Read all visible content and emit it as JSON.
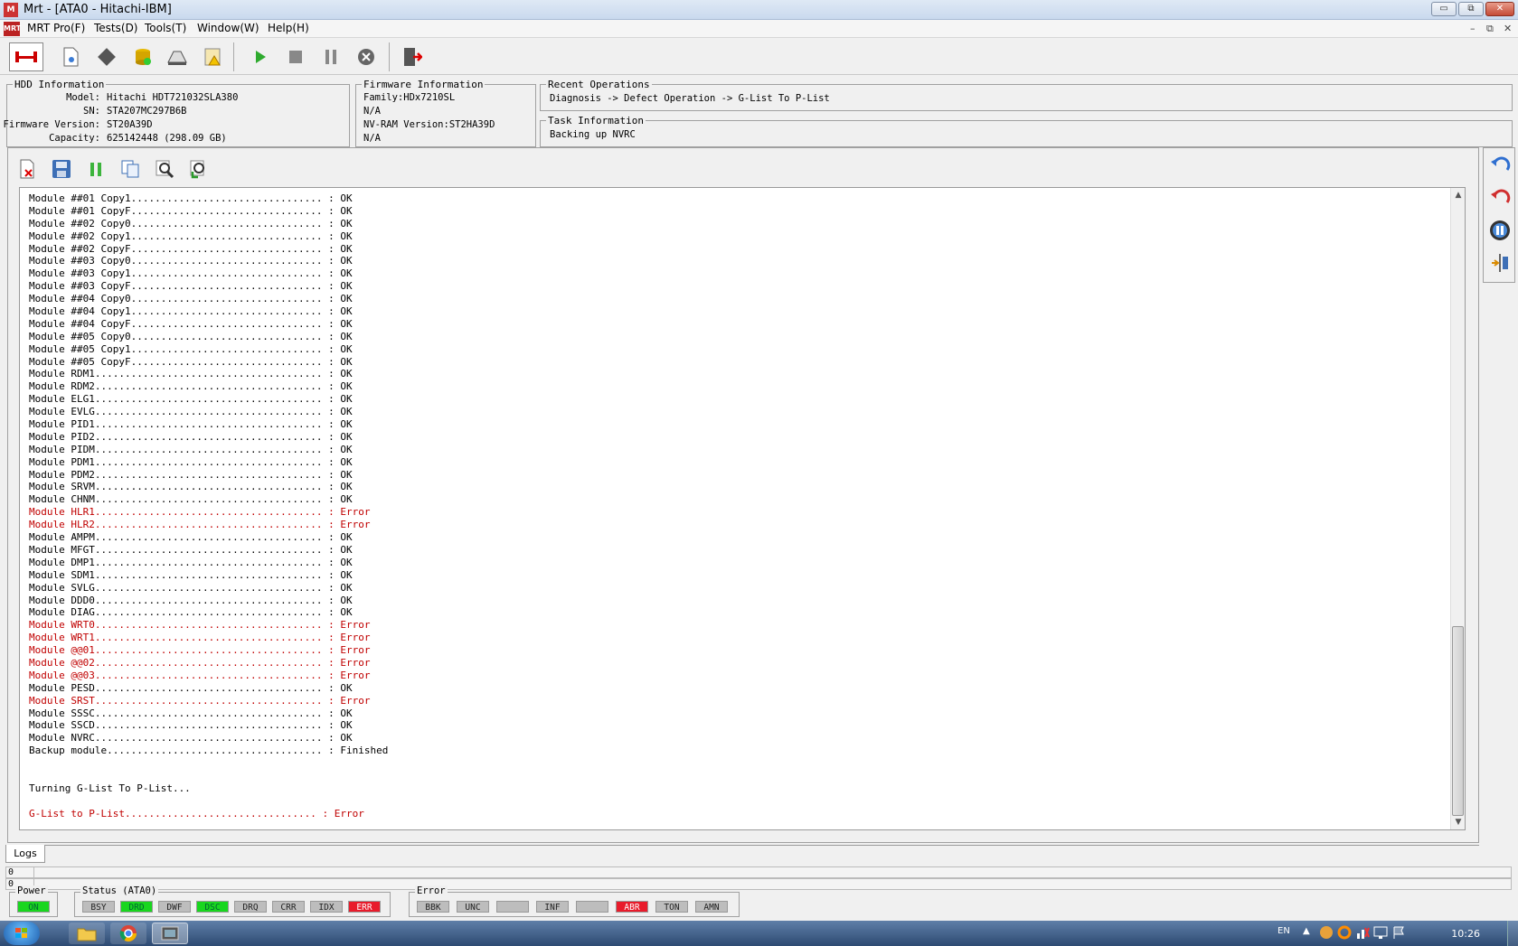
{
  "window": {
    "title": "Mrt - [ATA0 - Hitachi-IBM]",
    "minimize": "▭",
    "maximize": "⧉",
    "close": "✕"
  },
  "menu": {
    "logo": "MRT",
    "items": [
      "MRT Pro(F)",
      "Tests(D)",
      "Tools(T)",
      "Window(W)",
      "Help(H)"
    ],
    "mdi_controls": [
      "–",
      "⧉",
      "✕"
    ]
  },
  "toolbar": {
    "buttons": [
      "connect-icon",
      "file-icon",
      "chip-icon",
      "database-icon",
      "disk-icon",
      "warning-doc-icon",
      "play-icon",
      "stop-icon",
      "pause-icon",
      "cancel-icon",
      "exit-icon"
    ]
  },
  "hdd_info": {
    "legend": "HDD Information",
    "rows": [
      {
        "label": "Model:",
        "value": "Hitachi HDT721032SLA380"
      },
      {
        "label": "SN:",
        "value": "STA207MC297B6B"
      },
      {
        "label": "Firmware Version:",
        "value": "ST20A39D"
      },
      {
        "label": "Capacity:",
        "value": "625142448 (298.09 GB)"
      }
    ]
  },
  "firmware_info": {
    "legend": "Firmware Information",
    "rows": [
      "Family:HDx7210SL",
      "N/A",
      "NV-RAM Version:ST2HA39D",
      "N/A"
    ]
  },
  "recent_ops": {
    "legend": "Recent Operations",
    "text": "Diagnosis -> Defect Operation -> G-List To P-List"
  },
  "task_info": {
    "legend": "Task Information",
    "text": "Backing up NVRC"
  },
  "log": {
    "lines": [
      {
        "text": "Module ##01 Copy1................................ : OK",
        "error": false
      },
      {
        "text": "Module ##01 CopyF................................ : OK",
        "error": false
      },
      {
        "text": "Module ##02 Copy0................................ : OK",
        "error": false
      },
      {
        "text": "Module ##02 Copy1................................ : OK",
        "error": false
      },
      {
        "text": "Module ##02 CopyF................................ : OK",
        "error": false
      },
      {
        "text": "Module ##03 Copy0................................ : OK",
        "error": false
      },
      {
        "text": "Module ##03 Copy1................................ : OK",
        "error": false
      },
      {
        "text": "Module ##03 CopyF................................ : OK",
        "error": false
      },
      {
        "text": "Module ##04 Copy0................................ : OK",
        "error": false
      },
      {
        "text": "Module ##04 Copy1................................ : OK",
        "error": false
      },
      {
        "text": "Module ##04 CopyF................................ : OK",
        "error": false
      },
      {
        "text": "Module ##05 Copy0................................ : OK",
        "error": false
      },
      {
        "text": "Module ##05 Copy1................................ : OK",
        "error": false
      },
      {
        "text": "Module ##05 CopyF................................ : OK",
        "error": false
      },
      {
        "text": "Module RDM1...................................... : OK",
        "error": false
      },
      {
        "text": "Module RDM2...................................... : OK",
        "error": false
      },
      {
        "text": "Module ELG1...................................... : OK",
        "error": false
      },
      {
        "text": "Module EVLG...................................... : OK",
        "error": false
      },
      {
        "text": "Module PID1...................................... : OK",
        "error": false
      },
      {
        "text": "Module PID2...................................... : OK",
        "error": false
      },
      {
        "text": "Module PIDM...................................... : OK",
        "error": false
      },
      {
        "text": "Module PDM1...................................... : OK",
        "error": false
      },
      {
        "text": "Module PDM2...................................... : OK",
        "error": false
      },
      {
        "text": "Module SRVM...................................... : OK",
        "error": false
      },
      {
        "text": "Module CHNM...................................... : OK",
        "error": false
      },
      {
        "text": "Module HLR1...................................... : Error",
        "error": true
      },
      {
        "text": "Module HLR2...................................... : Error",
        "error": true
      },
      {
        "text": "Module AMPM...................................... : OK",
        "error": false
      },
      {
        "text": "Module MFGT...................................... : OK",
        "error": false
      },
      {
        "text": "Module DMP1...................................... : OK",
        "error": false
      },
      {
        "text": "Module SDM1...................................... : OK",
        "error": false
      },
      {
        "text": "Module SVLG...................................... : OK",
        "error": false
      },
      {
        "text": "Module DDD0...................................... : OK",
        "error": false
      },
      {
        "text": "Module DIAG...................................... : OK",
        "error": false
      },
      {
        "text": "Module WRT0...................................... : Error",
        "error": true
      },
      {
        "text": "Module WRT1...................................... : Error",
        "error": true
      },
      {
        "text": "Module @@01...................................... : Error",
        "error": true
      },
      {
        "text": "Module @@02...................................... : Error",
        "error": true
      },
      {
        "text": "Module @@03...................................... : Error",
        "error": true
      },
      {
        "text": "Module PESD...................................... : OK",
        "error": false
      },
      {
        "text": "Module SRST...................................... : Error",
        "error": true
      },
      {
        "text": "Module SSSC...................................... : OK",
        "error": false
      },
      {
        "text": "Module SSCD...................................... : OK",
        "error": false
      },
      {
        "text": "Module NVRC...................................... : OK",
        "error": false
      },
      {
        "text": "Backup module.................................... : Finished",
        "error": false
      },
      {
        "text": "",
        "error": false
      },
      {
        "text": "",
        "error": false
      },
      {
        "text": "Turning G-List To P-List...",
        "error": false
      },
      {
        "text": "",
        "error": false
      },
      {
        "text": "G-List to P-List................................ : Error",
        "error": true
      }
    ]
  },
  "logs_tab": "Logs",
  "counters": [
    "0",
    "0"
  ],
  "power": {
    "legend": "Power",
    "flag": "ON"
  },
  "status": {
    "legend": "Status (ATA0)",
    "flags": [
      {
        "label": "BSY",
        "state": "grey"
      },
      {
        "label": "DRD",
        "state": "green"
      },
      {
        "label": "DWF",
        "state": "grey"
      },
      {
        "label": "DSC",
        "state": "green"
      },
      {
        "label": "DRQ",
        "state": "grey"
      },
      {
        "label": "CRR",
        "state": "grey"
      },
      {
        "label": "IDX",
        "state": "grey"
      },
      {
        "label": "ERR",
        "state": "red"
      }
    ]
  },
  "error": {
    "legend": "Error",
    "flags": [
      {
        "label": "BBK",
        "state": "grey"
      },
      {
        "label": "UNC",
        "state": "grey"
      },
      {
        "label": "",
        "state": "grey"
      },
      {
        "label": "INF",
        "state": "grey"
      },
      {
        "label": "",
        "state": "grey"
      },
      {
        "label": "ABR",
        "state": "red"
      },
      {
        "label": "TON",
        "state": "grey"
      },
      {
        "label": "AMN",
        "state": "grey"
      }
    ]
  },
  "taskbar": {
    "language": "EN",
    "clock": "10:26"
  }
}
